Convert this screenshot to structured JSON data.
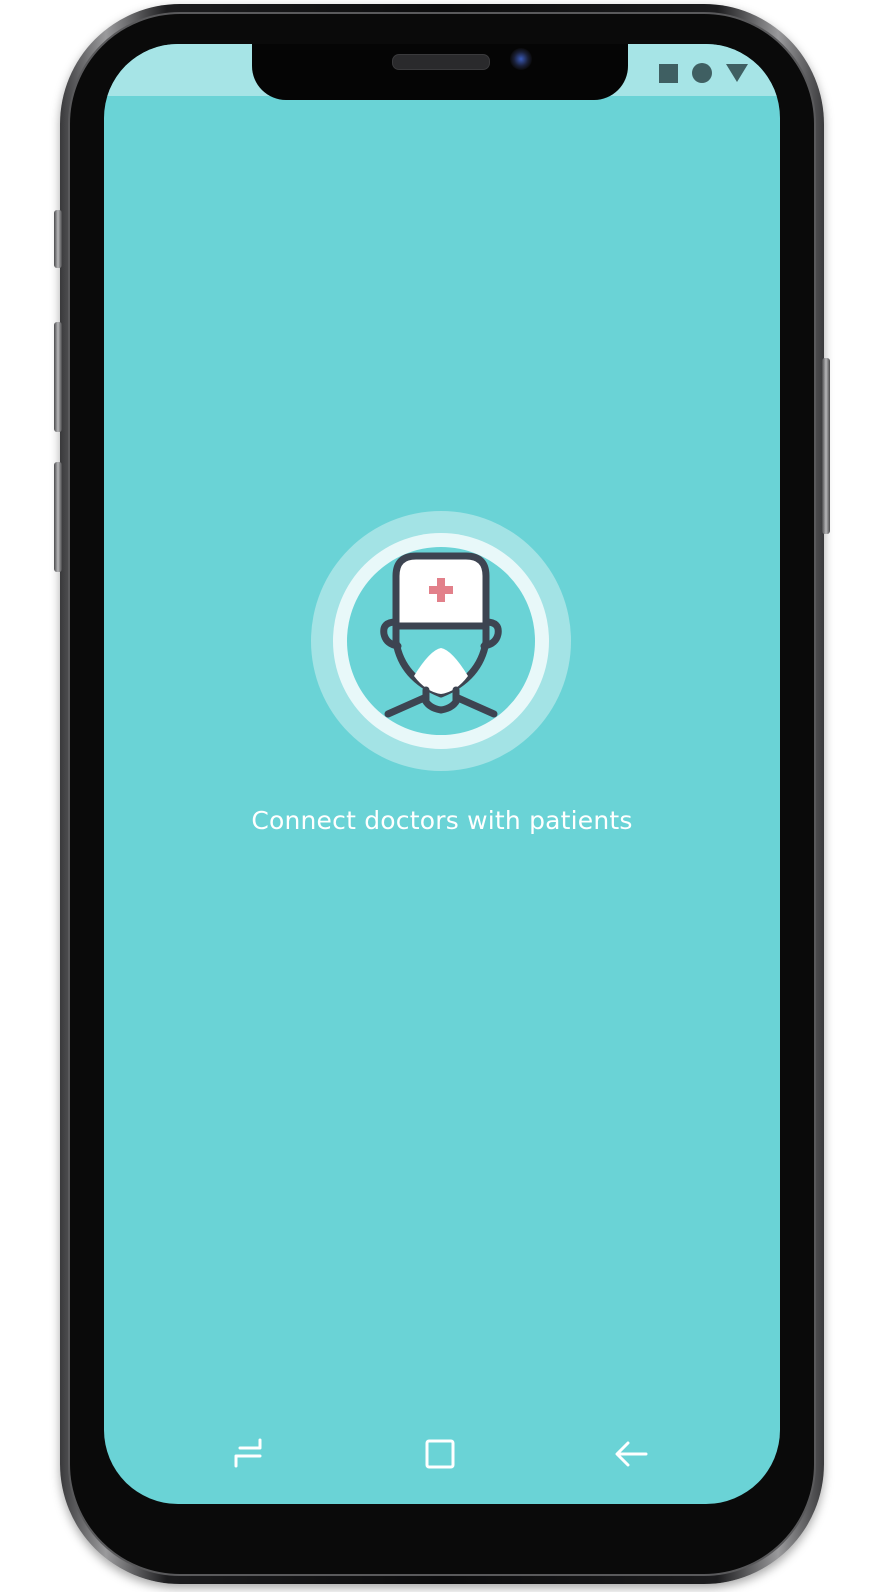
{
  "status_bar": {
    "icons": [
      "square-icon",
      "circle-icon",
      "triangle-icon"
    ]
  },
  "splash": {
    "logo_icon": "doctor-icon",
    "tagline": "Connect doctors with patients"
  },
  "nav_bar": {
    "buttons": [
      "recent-apps-icon",
      "home-icon",
      "back-icon"
    ]
  },
  "colors": {
    "background": "#6ad3d6",
    "status_bar": "#a6e4e6",
    "icon_stroke": "#3d4451",
    "cross": "#e2808a"
  }
}
